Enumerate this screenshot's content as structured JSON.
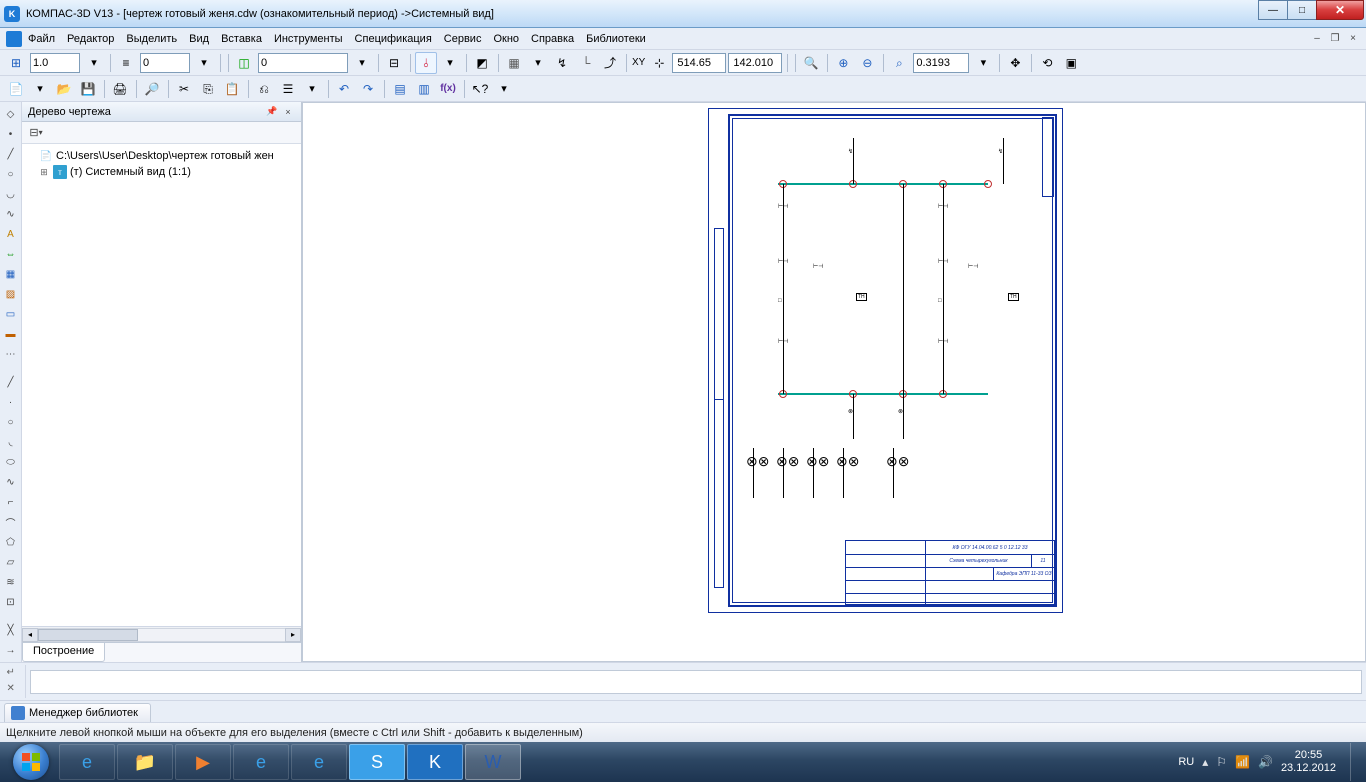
{
  "titlebar": {
    "app_icon_letter": "K",
    "title": "КОМПАС-3D V13 - [чертеж готовый женя.cdw (ознакомительный период) ->Системный вид]"
  },
  "menu": {
    "file": "Файл",
    "edit": "Редактор",
    "select": "Выделить",
    "view": "Вид",
    "insert": "Вставка",
    "tools": "Инструменты",
    "spec": "Спецификация",
    "service": "Сервис",
    "window": "Окно",
    "help": "Справка",
    "libs": "Библиотеки"
  },
  "toolbar1": {
    "line_weight": "1.0",
    "style_num": "0",
    "layer_num": "0",
    "coord_x": "514.65",
    "coord_y": "142.010",
    "zoom": "0.3193",
    "xy_label": "XY"
  },
  "tree": {
    "title": "Дерево чертежа",
    "root": "C:\\Users\\User\\Desktop\\чертеж готовый жен",
    "child": "(т) Системный вид (1:1)",
    "tab": "Построение"
  },
  "canvas": {
    "stamp_code": "КФ ОГУ 14.04.00.62  5 0 12.12 33",
    "stamp_title": "Схема четырехугольник",
    "stamp_dept": "Кафедра ЭПП 11-33 ОЗ",
    "stamp_num": "11"
  },
  "libtab": {
    "label": "Менеджер библиотек"
  },
  "status": {
    "hint": "Щелкните левой кнопкой мыши на объекте для его выделения (вместе с Ctrl или Shift - добавить к выделенным)"
  },
  "tray": {
    "lang": "RU",
    "time": "20:55",
    "date": "23.12.2012"
  }
}
